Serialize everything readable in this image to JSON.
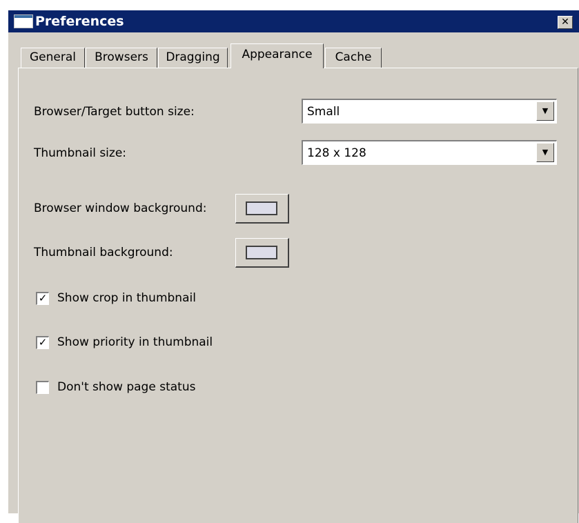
{
  "window": {
    "title": "Preferences",
    "close_glyph": "✕"
  },
  "tabs": [
    {
      "label": "General"
    },
    {
      "label": "Browsers"
    },
    {
      "label": "Dragging"
    },
    {
      "label": "Appearance"
    },
    {
      "label": "Cache"
    }
  ],
  "active_tab": "Appearance",
  "appearance": {
    "button_size": {
      "label": "Browser/Target button size:",
      "value": "Small"
    },
    "thumbnail_size": {
      "label": "Thumbnail size:",
      "value": "128 x 128"
    },
    "browser_bg": {
      "label": "Browser window background:",
      "color": "#dcdce8"
    },
    "thumbnail_bg": {
      "label": "Thumbnail background:",
      "color": "#dcdce8"
    },
    "show_crop": {
      "label": "Show crop in thumbnail",
      "checked": true,
      "glyph": "✓"
    },
    "show_priority": {
      "label": "Show priority in thumbnail",
      "checked": true,
      "glyph": "✓"
    },
    "hide_page_status": {
      "label": "Don't show page status",
      "checked": false,
      "glyph": ""
    }
  },
  "dropdown_arrow": "▼"
}
